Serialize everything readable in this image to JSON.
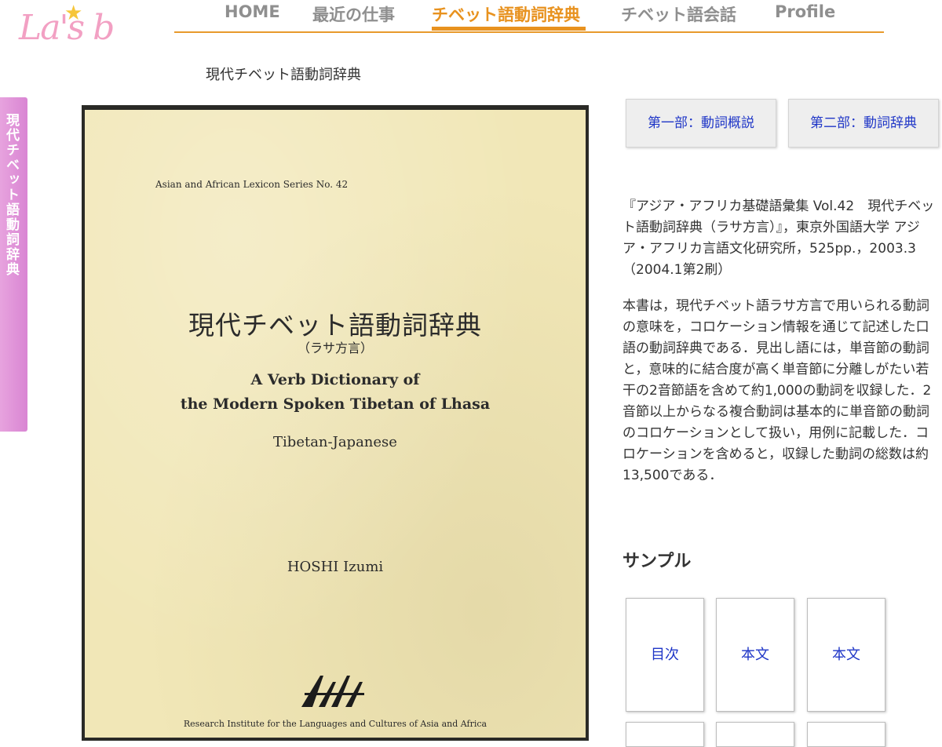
{
  "header": {
    "logo_text": "La's b",
    "nav": [
      {
        "label": "HOME",
        "active": false
      },
      {
        "label": "最近の仕事",
        "active": false
      },
      {
        "label": "チベット語動詞辞典",
        "active": true
      },
      {
        "label": "チベット語会話",
        "active": false
      },
      {
        "label": "Profile",
        "active": false
      }
    ],
    "accent_color": "#e8921f"
  },
  "breadcrumb": "現代チベット語動詞辞典",
  "side_tab": {
    "label": "現代チベット語動詞辞典",
    "color": "#d985d3"
  },
  "cover": {
    "series": "Asian and African Lexicon Series No. 42",
    "title_jp": "現代チベット語動詞辞典",
    "subtitle_jp": "（ラサ方言）",
    "title_en_line1": "A Verb Dictionary of",
    "title_en_line2": "the Modern Spoken Tibetan of Lhasa",
    "subtitle_en": "Tibetan-Japanese",
    "author": "HOSHI Izumi",
    "publisher": "Research Institute for the Languages and Cultures of Asia and Africa"
  },
  "parts": [
    {
      "label": "第一部：動詞概説"
    },
    {
      "label": "第二部：動詞辞典"
    }
  ],
  "description": {
    "citation": "『アジア・アフリカ基礎語彙集 Vol.42　現代チベット語動詞辞典（ラサ方言）』，東京外国語大学 アジア・アフリカ言語文化研究所，525pp.，2003.3 （2004.1第2刷）",
    "body": "本書は，現代チベット語ラサ方言で用いられる動詞の意味を，コロケーション情報を通じて記述した口語の動詞辞典である．見出し語には，単音節の動詞と，意味的に結合度が高く単音節に分離しがたい若干の2音節語を含めて約1,000の動詞を収録した．2音節以上からなる複合動詞は基本的に単音節の動詞のコロケーションとして扱い，用例に記載した．コロケーションを含めると，収録した動詞の総数は約13,500である．"
  },
  "sample": {
    "heading": "サンプル",
    "cards": [
      {
        "label": "目次"
      },
      {
        "label": "本文"
      },
      {
        "label": "本文"
      }
    ]
  }
}
